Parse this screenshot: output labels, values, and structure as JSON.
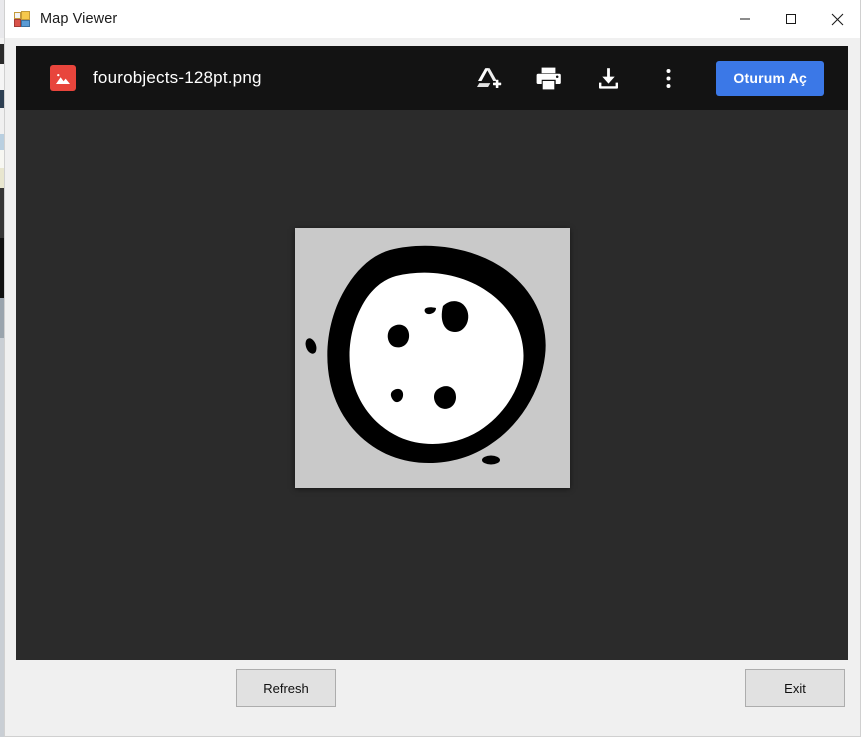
{
  "window": {
    "title": "Map Viewer",
    "app_icon": "windows-forms-app-icon",
    "controls": [
      {
        "name": "minimize",
        "glyph": "minimize-icon"
      },
      {
        "name": "maximize",
        "glyph": "maximize-icon"
      },
      {
        "name": "close",
        "glyph": "close-icon"
      }
    ]
  },
  "viewer": {
    "background_color": "#2b2b2b",
    "toolbar": {
      "background_color": "#131313",
      "file_icon": "image-file-icon",
      "file_icon_color": "#e8453c",
      "file_name": "fourobjects-128pt.png",
      "actions": [
        {
          "name": "add-to-drive",
          "icon": "drive-add-icon"
        },
        {
          "name": "print",
          "icon": "printer-icon"
        },
        {
          "name": "download",
          "icon": "download-icon"
        },
        {
          "name": "more-options",
          "icon": "three-dots-vertical-icon"
        }
      ],
      "signin_label": "Oturum Aç",
      "signin_color": "#3b78e7"
    },
    "image": {
      "alt": "Binary thresholded image: large white blob with thick black outline containing four small black objects",
      "canvas_color": "#c9c9c9",
      "blob_fill": "#ffffff",
      "outline_fill": "#000000",
      "object_count": 4
    }
  },
  "footer": {
    "refresh_label": "Refresh",
    "exit_label": "Exit"
  }
}
